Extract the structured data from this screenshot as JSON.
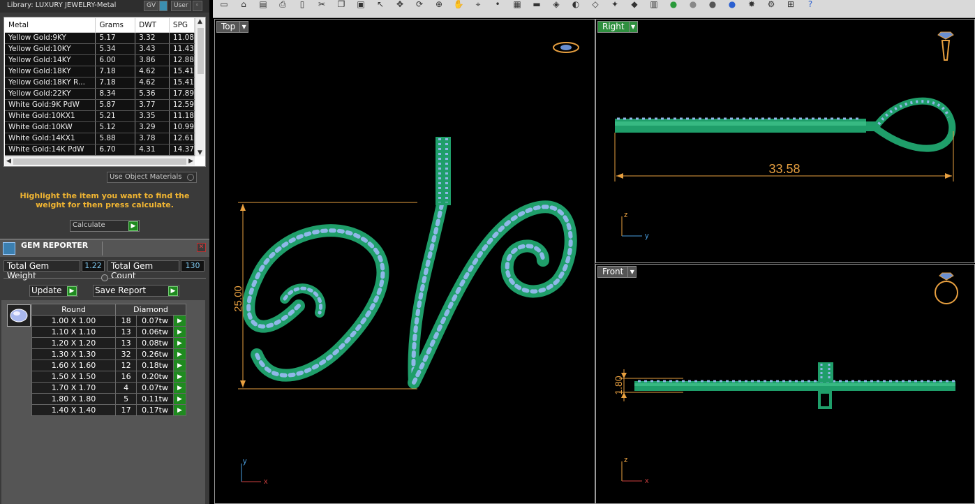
{
  "library": {
    "title": "Library: LUXURY JEWELRY-Metal",
    "gv_label": "GV",
    "user_label": "User",
    "columns": [
      "Metal",
      "Grams",
      "DWT",
      "SPG"
    ],
    "rows": [
      [
        "Yellow Gold:9KY",
        "5.17",
        "3.32",
        "11.08"
      ],
      [
        "Yellow Gold:10KY",
        "5.34",
        "3.43",
        "11.43"
      ],
      [
        "Yellow Gold:14KY",
        "6.00",
        "3.86",
        "12.88"
      ],
      [
        "Yellow Gold:18KY",
        "7.18",
        "4.62",
        "15.41"
      ],
      [
        "Yellow Gold:18KY R...",
        "7.18",
        "4.62",
        "15.41"
      ],
      [
        "Yellow Gold:22KY",
        "8.34",
        "5.36",
        "17.89"
      ],
      [
        "White Gold:9K PdW",
        "5.87",
        "3.77",
        "12.59"
      ],
      [
        "White Gold:10KX1",
        "5.21",
        "3.35",
        "11.18"
      ],
      [
        "White Gold:10KW",
        "5.12",
        "3.29",
        "10.99"
      ],
      [
        "White Gold:14KX1",
        "5.88",
        "3.78",
        "12.61"
      ],
      [
        "White Gold:14K PdW",
        "6.70",
        "4.31",
        "14.37"
      ]
    ],
    "use_object_materials": "Use Object Materials",
    "hint": "Highlight the item you want to find the weight for then press calculate.",
    "calculate_label": "Calculate"
  },
  "gem_reporter": {
    "title": "GEM REPORTER",
    "total_weight_label": "Total Gem Weight",
    "total_weight_value": "1.22",
    "total_count_label": "Total Gem Count",
    "total_count_value": "130",
    "update_label": "Update",
    "save_report_label": "Save Report",
    "shape_header": "Round",
    "material_header": "Diamond",
    "gems": [
      [
        "1.00 X 1.00",
        "18",
        "0.07tw"
      ],
      [
        "1.10 X 1.10",
        "13",
        "0.06tw"
      ],
      [
        "1.20 X 1.20",
        "13",
        "0.08tw"
      ],
      [
        "1.30 X 1.30",
        "32",
        "0.26tw"
      ],
      [
        "1.60 X 1.60",
        "12",
        "0.18tw"
      ],
      [
        "1.50 X 1.50",
        "16",
        "0.20tw"
      ],
      [
        "1.70 X 1.70",
        "4",
        "0.07tw"
      ],
      [
        "1.80 X 1.80",
        "5",
        "0.11tw"
      ],
      [
        "1.40 X 1.40",
        "17",
        "0.17tw"
      ]
    ]
  },
  "viewports": {
    "top": {
      "label": "Top",
      "dimension": "25.00",
      "axis_y": "y",
      "axis_x": "x"
    },
    "right": {
      "label": "Right",
      "dimension": "33.58",
      "axis_z": "z",
      "axis_y": "y"
    },
    "front": {
      "label": "Front",
      "dimension": "1.80",
      "axis_z": "z",
      "axis_x": "x"
    }
  },
  "colors": {
    "metal_green": "#1f9e6a",
    "gem_blue": "#8fb8e8",
    "dimension_orange": "#e8a040",
    "hint_yellow": "#f2b632"
  },
  "toolbar_icons": [
    "new-file-icon",
    "open-folder-icon",
    "save-icon",
    "print-icon",
    "page-icon",
    "cut-icon",
    "copy-icon",
    "paste-icon",
    "select-icon",
    "move-icon",
    "rotate-icon",
    "zoom-icon",
    "pan-icon",
    "snap-icon",
    "point-icon",
    "grid-icon",
    "car-icon",
    "render-icon",
    "shade-icon",
    "wire-icon",
    "lamp-icon",
    "gem-icon",
    "layer-icon",
    "sphere-green-icon",
    "sphere-gray-icon",
    "sphere-dark-icon",
    "sphere-blue-icon",
    "light-icon",
    "settings-icon",
    "tree-icon",
    "help-icon"
  ]
}
